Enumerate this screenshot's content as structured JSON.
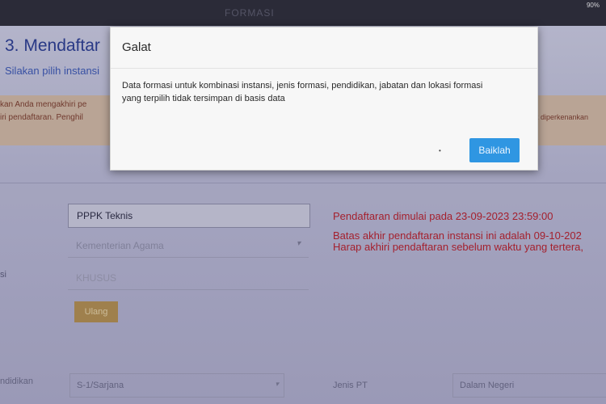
{
  "topbar": {
    "title": "FORMASI",
    "battery": "90%"
  },
  "step": {
    "title": "3. Mendaftar",
    "subtitle": "Silakan pilih instansi"
  },
  "notice": {
    "line1": "kan Anda mengakhiri pe",
    "line2": "iri pendaftaran. Penghil",
    "right": "k diperkenankan"
  },
  "form": {
    "jenis_formasi": "PPPK Teknis",
    "instansi": "Kementerian Agama",
    "formasi": "KHUSUS",
    "left_label": "si",
    "ulang_label": "Ulang"
  },
  "info": {
    "line1": "Pendaftaran dimulai pada 23-09-2023 23:59:00",
    "line2": "Batas akhir pendaftaran instansi ini adalah  09-10-202",
    "line3": "Harap akhiri pendaftaran sebelum waktu yang tertera,"
  },
  "bottom": {
    "pendidikan_label": "ndidikan",
    "pendidikan_value": "S-1/Sarjana",
    "jenis_pt_label": "Jenis PT",
    "jenis_pt_value": "Dalam Negeri"
  },
  "modal": {
    "title": "Galat",
    "message": "Data formasi untuk kombinasi instansi, jenis formasi, pendidikan, jabatan dan lokasi formasi yang terpilih tidak tersimpan di basis data",
    "button": "Baiklah"
  },
  "colors": {
    "accent": "#2f96e2",
    "error_text": "#b51f2a",
    "notice_bg": "#cdb5a0"
  },
  "icons": [
    "chevron-down-icon"
  ]
}
